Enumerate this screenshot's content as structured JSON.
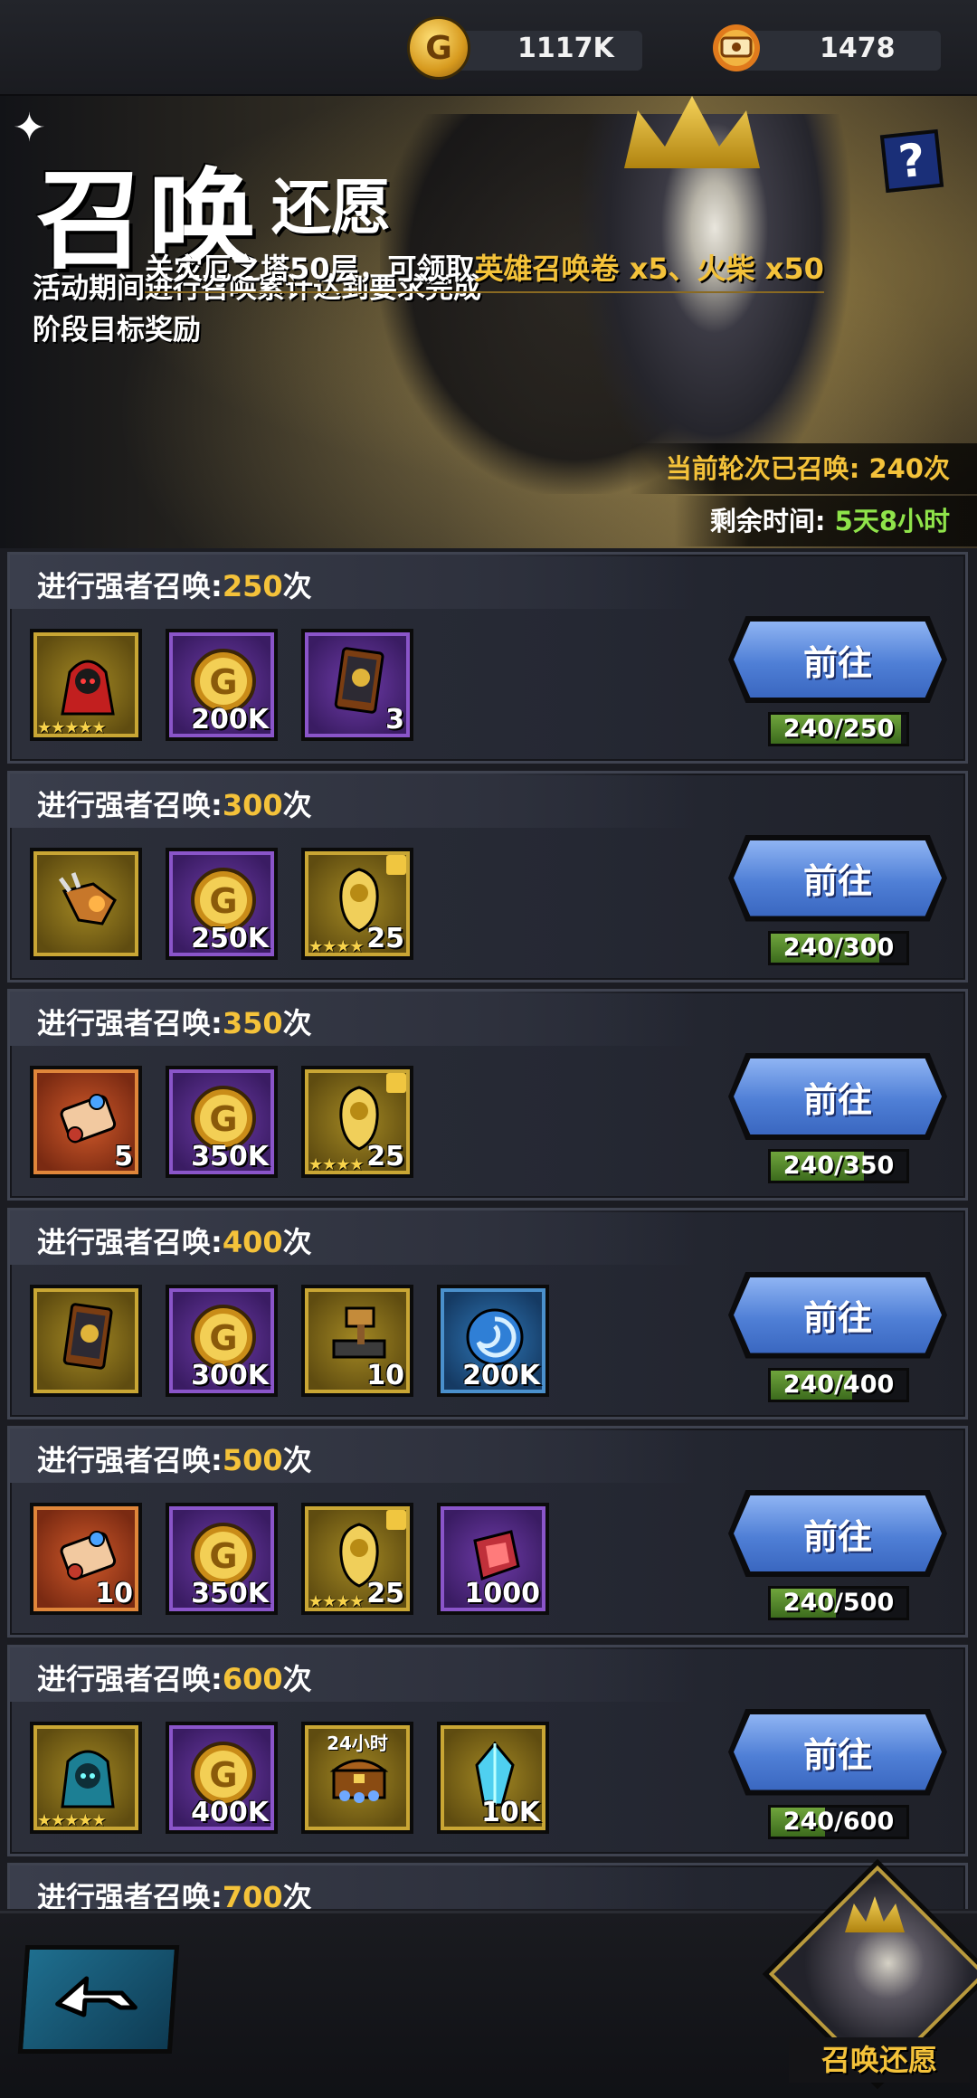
{
  "currencies": [
    {
      "icon": "gold-coin-icon",
      "value": "1117K"
    },
    {
      "icon": "summon-scroll-icon",
      "value": "1478"
    }
  ],
  "banner": {
    "title_big": "召唤",
    "title_small": "还愿",
    "tip_prefix": "关灾厄之塔50层，可领取",
    "tip_highlight": "英雄召唤卷 x5、火柴 x50",
    "description": "活动期间进行召唤累计达到要求完成阶段目标奖励",
    "summoned_label": "当前轮次已召唤:",
    "summoned_value": "240次",
    "remaining_label": "剩余时间:",
    "remaining_value": "5天8小时"
  },
  "rows": [
    {
      "title": "进行强者召唤:",
      "count": "250",
      "unit": "次",
      "button": "前往",
      "progress": "240/250",
      "fraction": 0.96,
      "items": [
        {
          "icon": "red-hero-icon",
          "frame": "gold",
          "label": "",
          "stars": "★★★★★"
        },
        {
          "icon": "gold-coin-icon",
          "frame": "purple",
          "label": "200K"
        },
        {
          "icon": "hero-card-icon",
          "frame": "purple",
          "label": "3"
        }
      ]
    },
    {
      "title": "进行强者召唤:",
      "count": "300",
      "unit": "次",
      "button": "前往",
      "progress": "240/300",
      "fraction": 0.8,
      "items": [
        {
          "icon": "gauntlet-icon",
          "frame": "gold",
          "label": ""
        },
        {
          "icon": "gold-coin-icon",
          "frame": "purple",
          "label": "250K"
        },
        {
          "icon": "hero-shard-icon",
          "frame": "gold",
          "label": "25",
          "stars": "★★★★"
        }
      ]
    },
    {
      "title": "进行强者召唤:",
      "count": "350",
      "unit": "次",
      "button": "前往",
      "progress": "240/350",
      "fraction": 0.686,
      "items": [
        {
          "icon": "summon-scroll-icon",
          "frame": "orange",
          "label": "5"
        },
        {
          "icon": "gold-coin-icon",
          "frame": "purple",
          "label": "350K"
        },
        {
          "icon": "hero-shard-icon",
          "frame": "gold",
          "label": "25",
          "stars": "★★★★"
        }
      ]
    },
    {
      "title": "进行强者召唤:",
      "count": "400",
      "unit": "次",
      "button": "前往",
      "progress": "240/400",
      "fraction": 0.6,
      "items": [
        {
          "icon": "hero-card-icon",
          "frame": "gold",
          "label": ""
        },
        {
          "icon": "gold-coin-icon",
          "frame": "purple",
          "label": "300K"
        },
        {
          "icon": "anvil-hammer-icon",
          "frame": "gold",
          "label": "10"
        },
        {
          "icon": "blue-orb-icon",
          "frame": "blue",
          "label": "200K"
        }
      ]
    },
    {
      "title": "进行强者召唤:",
      "count": "500",
      "unit": "次",
      "button": "前往",
      "progress": "240/500",
      "fraction": 0.48,
      "items": [
        {
          "icon": "summon-scroll-icon",
          "frame": "orange",
          "label": "10"
        },
        {
          "icon": "gold-coin-icon",
          "frame": "purple",
          "label": "350K"
        },
        {
          "icon": "hero-shard-icon",
          "frame": "gold",
          "label": "25",
          "stars": "★★★★"
        },
        {
          "icon": "red-gem-icon",
          "frame": "purple",
          "label": "1000"
        }
      ]
    },
    {
      "title": "进行强者召唤:",
      "count": "600",
      "unit": "次",
      "button": "前往",
      "progress": "240/600",
      "fraction": 0.4,
      "items": [
        {
          "icon": "blue-hero-icon",
          "frame": "gold",
          "label": "",
          "stars": "★★★★★"
        },
        {
          "icon": "gold-coin-icon",
          "frame": "purple",
          "label": "400K"
        },
        {
          "icon": "treasure-chest-icon",
          "frame": "gold",
          "label": "",
          "toplabel": "24小时"
        },
        {
          "icon": "crystal-icon",
          "frame": "gold",
          "label": "10K"
        }
      ]
    },
    {
      "title": "进行强者召唤:",
      "count": "700",
      "unit": "次",
      "button": "前往",
      "progress": "",
      "fraction": 0,
      "items": []
    }
  ],
  "bottom": {
    "back_icon": "back-arrow-icon",
    "portrait_label": "召唤还愿"
  }
}
